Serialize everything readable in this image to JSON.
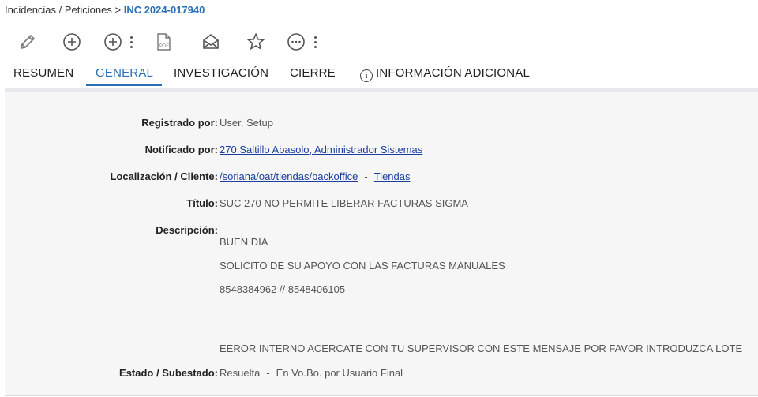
{
  "breadcrumb": {
    "parent": "Incidencias / Peticiones",
    "separator": ">",
    "current": "INC 2024-017940"
  },
  "toolbar": {
    "icons": [
      "pencil-icon",
      "add-circle-icon",
      "add-circle-more-icon",
      "pdf-icon",
      "envelope-open-icon",
      "star-icon",
      "more-circle-icon"
    ]
  },
  "tabs": {
    "resumen": "RESUMEN",
    "general": "GENERAL",
    "investigacion": "INVESTIGACIÓN",
    "cierre": "CIERRE",
    "info_adicional": "INFORMACIÓN ADICIONAL",
    "active": "GENERAL"
  },
  "fields": {
    "registrado": {
      "label": "Registrado por:",
      "value": "User, Setup"
    },
    "notificado": {
      "label": "Notificado por:",
      "value": "270 Saltillo Abasolo, Administrador Sistemas"
    },
    "localizacion": {
      "label": "Localización / Cliente:",
      "location": "/soriana/oat/tiendas/backoffice",
      "separator": "-",
      "client": "Tiendas"
    },
    "titulo": {
      "label": "Título:",
      "value": "SUC 270 NO PERMITE LIBERAR FACTURAS SIGMA"
    },
    "descripcion": {
      "label": "Descripción:",
      "lines": [
        "BUEN DIA",
        "SOLICITO DE SU APOYO CON LAS FACTURAS MANUALES",
        "8548384962 // 8548406105",
        "EEROR INTERNO ACERCATE CON TU SUPERVISOR CON ESTE MENSAJE POR FAVOR INTRODUZCA LOTE"
      ]
    },
    "estado": {
      "label": "Estado / Subestado:",
      "estado": "Resuelta",
      "separator": "-",
      "subestado": "En Vo.Bo. por Usuario Final"
    }
  },
  "colors": {
    "accent": "#2a6fb6",
    "link": "#1a3fa0",
    "panel_bg": "#f6f6f6"
  }
}
